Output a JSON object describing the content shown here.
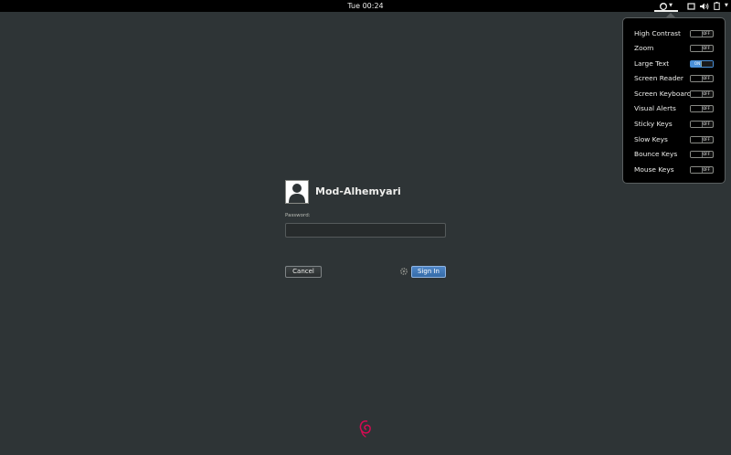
{
  "topbar": {
    "clock": "Tue 00:24",
    "accessibility_icon": "universal-access-icon",
    "system_icons": [
      "display-icon",
      "volume-icon",
      "battery-icon"
    ]
  },
  "a11y_menu": {
    "items": [
      {
        "label": "High Contrast",
        "state": "OFF",
        "on": false
      },
      {
        "label": "Zoom",
        "state": "OFF",
        "on": false
      },
      {
        "label": "Large Text",
        "state": "ON",
        "on": true
      },
      {
        "label": "Screen Reader",
        "state": "OFF",
        "on": false
      },
      {
        "label": "Screen Keyboard",
        "state": "OFF",
        "on": false
      },
      {
        "label": "Visual Alerts",
        "state": "OFF",
        "on": false
      },
      {
        "label": "Sticky Keys",
        "state": "OFF",
        "on": false
      },
      {
        "label": "Slow Keys",
        "state": "OFF",
        "on": false
      },
      {
        "label": "Bounce Keys",
        "state": "OFF",
        "on": false
      },
      {
        "label": "Mouse Keys",
        "state": "OFF",
        "on": false
      }
    ]
  },
  "login": {
    "username": "Mod-Alhemyari",
    "password_label": "Password:",
    "password_value": "",
    "cancel_label": "Cancel",
    "signin_label": "Sign In"
  },
  "colors": {
    "background": "#2e3436",
    "panel": "#000000",
    "accent": "#4a90d9",
    "logo": "#d70a53"
  }
}
